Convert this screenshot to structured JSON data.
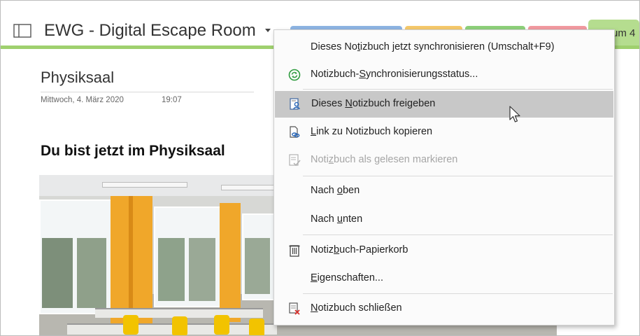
{
  "notebook": {
    "title": "EWG - Digital Escape Room",
    "last_tab_label": "um 4",
    "tab_colors": [
      "#8db4e2",
      "#f5c96b",
      "#8dd07a",
      "#f19aa0",
      "#b5dd8f"
    ]
  },
  "page": {
    "title": "Physiksaal",
    "date": "Mittwoch, 4. März 2020",
    "time": "19:07",
    "heading": "Du bist jetzt im Physiksaal"
  },
  "menu": {
    "items": [
      {
        "pre": "Dieses No",
        "acc": "t",
        "post": "izbuch jetzt synchronisieren  (Umschalt+F9)",
        "icon": "none",
        "state": "normal"
      },
      {
        "pre": "Notizbuch-",
        "acc": "S",
        "post": "ynchronisierungsstatus...",
        "icon": "sync-status-icon",
        "state": "normal"
      },
      {
        "pre": "Dieses ",
        "acc": "N",
        "post": "otizbuch freigeben",
        "icon": "share-notebook-icon",
        "state": "hover"
      },
      {
        "pre": "",
        "acc": "L",
        "post": "ink zu Notizbuch kopieren",
        "icon": "copy-link-icon",
        "state": "normal"
      },
      {
        "pre": "Noti",
        "acc": "z",
        "post": "buch als gelesen markieren",
        "icon": "mark-read-icon",
        "state": "disabled"
      },
      {
        "pre": "Nach ",
        "acc": "o",
        "post": "ben",
        "icon": "none",
        "state": "normal"
      },
      {
        "pre": "Nach ",
        "acc": "u",
        "post": "nten",
        "icon": "none",
        "state": "normal"
      },
      {
        "pre": "Notiz",
        "acc": "b",
        "post": "uch-Papierkorb",
        "icon": "recycle-bin-icon",
        "state": "normal"
      },
      {
        "pre": "",
        "acc": "E",
        "post": "igenschaften...",
        "icon": "none",
        "state": "normal"
      },
      {
        "pre": "",
        "acc": "N",
        "post": "otizbuch schließen",
        "icon": "close-notebook-icon",
        "state": "normal"
      }
    ]
  },
  "colors": {
    "accent_green": "#9fd06e",
    "sync_icon": "#2e9b3e",
    "hover_bg": "#c8c8c8"
  }
}
